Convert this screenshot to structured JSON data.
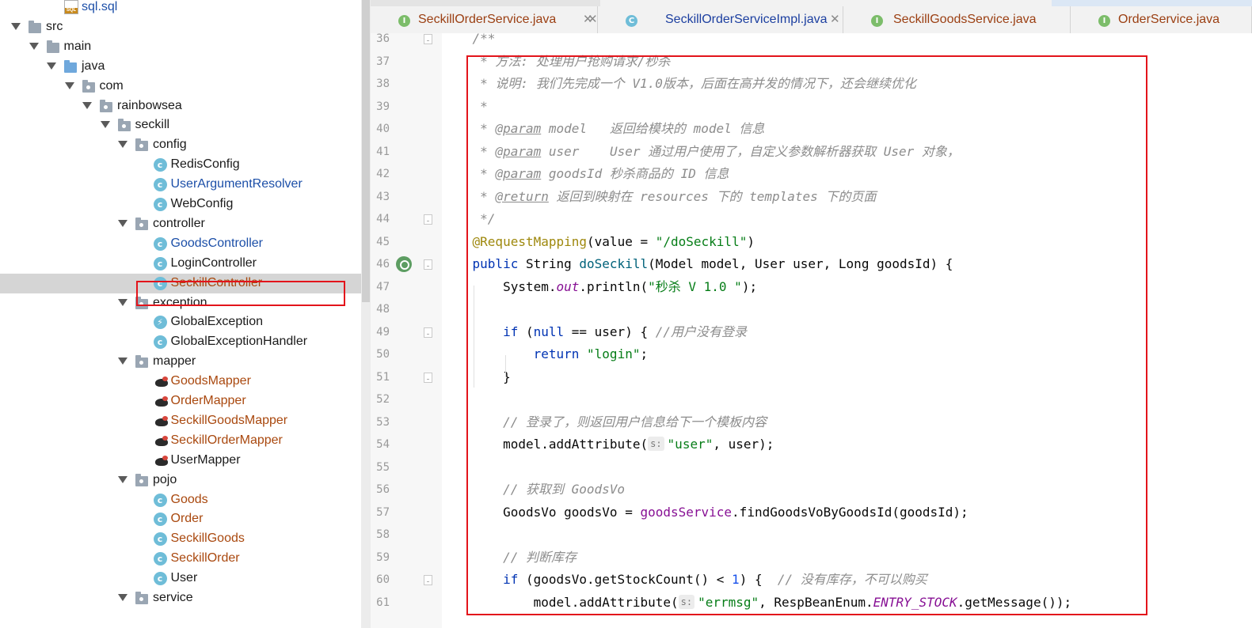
{
  "project_tree": {
    "items": [
      {
        "label": "sql.sql",
        "icon": "sql-file-icon",
        "kind": "sql",
        "color": "blue"
      },
      {
        "label": "src",
        "icon": "folder-icon",
        "kind": "folder",
        "expanded": true
      },
      {
        "label": "main",
        "icon": "folder-icon",
        "kind": "folder",
        "expanded": true
      },
      {
        "label": "java",
        "icon": "source-folder-icon",
        "kind": "srcfolder",
        "expanded": true
      },
      {
        "label": "com",
        "icon": "package-icon",
        "kind": "package",
        "expanded": true
      },
      {
        "label": "rainbowsea",
        "icon": "package-icon",
        "kind": "package",
        "expanded": true
      },
      {
        "label": "seckill",
        "icon": "package-icon",
        "kind": "package",
        "expanded": true
      },
      {
        "label": "config",
        "icon": "package-icon",
        "kind": "package",
        "expanded": true
      },
      {
        "label": "RedisConfig",
        "icon": "class-icon",
        "kind": "class"
      },
      {
        "label": "UserArgumentResolver",
        "icon": "class-icon",
        "kind": "class",
        "color": "blue"
      },
      {
        "label": "WebConfig",
        "icon": "class-icon",
        "kind": "class"
      },
      {
        "label": "controller",
        "icon": "package-icon",
        "kind": "package",
        "expanded": true
      },
      {
        "label": "GoodsController",
        "icon": "class-icon",
        "kind": "class",
        "color": "blue"
      },
      {
        "label": "LoginController",
        "icon": "class-icon",
        "kind": "class"
      },
      {
        "label": "SeckillController",
        "icon": "class-icon",
        "kind": "class",
        "color": "brown",
        "selected": true
      },
      {
        "label": "exception",
        "icon": "package-icon",
        "kind": "package",
        "expanded": true
      },
      {
        "label": "GlobalException",
        "icon": "exception-class-icon",
        "kind": "exception"
      },
      {
        "label": "GlobalExceptionHandler",
        "icon": "class-icon",
        "kind": "class"
      },
      {
        "label": "mapper",
        "icon": "package-icon",
        "kind": "package",
        "expanded": true
      },
      {
        "label": "GoodsMapper",
        "icon": "mybatis-mapper-icon",
        "kind": "mapper",
        "color": "brown"
      },
      {
        "label": "OrderMapper",
        "icon": "mybatis-mapper-icon",
        "kind": "mapper",
        "color": "brown"
      },
      {
        "label": "SeckillGoodsMapper",
        "icon": "mybatis-mapper-icon",
        "kind": "mapper",
        "color": "brown"
      },
      {
        "label": "SeckillOrderMapper",
        "icon": "mybatis-mapper-icon",
        "kind": "mapper",
        "color": "brown"
      },
      {
        "label": "UserMapper",
        "icon": "mybatis-mapper-icon",
        "kind": "mapper"
      },
      {
        "label": "pojo",
        "icon": "package-icon",
        "kind": "package",
        "expanded": true
      },
      {
        "label": "Goods",
        "icon": "class-icon",
        "kind": "class",
        "color": "brown"
      },
      {
        "label": "Order",
        "icon": "class-icon",
        "kind": "class",
        "color": "brown"
      },
      {
        "label": "SeckillGoods",
        "icon": "class-icon",
        "kind": "class",
        "color": "brown"
      },
      {
        "label": "SeckillOrder",
        "icon": "class-icon",
        "kind": "class",
        "color": "brown"
      },
      {
        "label": "User",
        "icon": "class-icon",
        "kind": "class"
      },
      {
        "label": "service",
        "icon": "package-icon",
        "kind": "package",
        "expanded": true
      }
    ]
  },
  "editor_tabs": [
    {
      "label": "SeckillOrderService.java",
      "icon": "interface-icon",
      "kind": "i",
      "color": "brown"
    },
    {
      "label": "SeckillOrderServiceImpl.java",
      "icon": "class-icon",
      "kind": "c",
      "color": "blue"
    },
    {
      "label": "SeckillGoodsService.java",
      "icon": "interface-icon",
      "kind": "i",
      "color": "brown"
    },
    {
      "label": "OrderService.java",
      "icon": "interface-icon",
      "kind": "i",
      "color": "brown"
    }
  ],
  "editor": {
    "line_numbers": [
      "36",
      "37",
      "38",
      "39",
      "40",
      "41",
      "42",
      "43",
      "44",
      "45",
      "46",
      "47",
      "48",
      "49",
      "50",
      "51",
      "52",
      "53",
      "54",
      "55",
      "56",
      "57",
      "58",
      "59",
      "60",
      "61"
    ],
    "lines": [
      [
        {
          "t": "    /**",
          "c": "cm"
        }
      ],
      [
        {
          "t": "     * 方法: 处理用户抢购请求/秒杀",
          "c": "cm"
        }
      ],
      [
        {
          "t": "     * 说明: 我们先完成一个 V1.0版本，后面在高并发的情况下，还会继续优化",
          "c": "cm"
        }
      ],
      [
        {
          "t": "     *",
          "c": "cm"
        }
      ],
      [
        {
          "t": "     * ",
          "c": "cm"
        },
        {
          "t": "@param",
          "c": "tagp"
        },
        {
          "t": " model",
          "c": "cm"
        },
        {
          "t": "   返回给模块的 model 信息",
          "c": "cm"
        }
      ],
      [
        {
          "t": "     * ",
          "c": "cm"
        },
        {
          "t": "@param",
          "c": "tagp"
        },
        {
          "t": " user",
          "c": "cm"
        },
        {
          "t": "    User 通过用户使用了，自定义参数解析器获取 User 对象，",
          "c": "cm"
        }
      ],
      [
        {
          "t": "     * ",
          "c": "cm"
        },
        {
          "t": "@param",
          "c": "tagp"
        },
        {
          "t": " goodsId",
          "c": "cm"
        },
        {
          "t": " 秒杀商品的 ID 信息",
          "c": "cm"
        }
      ],
      [
        {
          "t": "     * ",
          "c": "cm"
        },
        {
          "t": "@return",
          "c": "tagp"
        },
        {
          "t": " 返回到映射在 resources 下的 templates 下的页面",
          "c": "cm"
        }
      ],
      [
        {
          "t": "     */",
          "c": "cm"
        }
      ],
      [
        {
          "t": "    "
        },
        {
          "t": "@RequestMapping",
          "c": "ann"
        },
        {
          "t": "(value = "
        },
        {
          "t": "\"/doSeckill\"",
          "c": "str"
        },
        {
          "t": ")"
        }
      ],
      [
        {
          "t": "    "
        },
        {
          "t": "public",
          "c": "kw"
        },
        {
          "t": " String "
        },
        {
          "t": "doSeckill",
          "c": "mth"
        },
        {
          "t": "(Model model, User user, Long goodsId) {"
        }
      ],
      [
        {
          "t": "        System."
        },
        {
          "t": "out",
          "c": "stf"
        },
        {
          "t": ".println("
        },
        {
          "t": "\"秒杀 V 1.0 \"",
          "c": "str"
        },
        {
          "t": ");"
        }
      ],
      [
        {
          "t": ""
        }
      ],
      [
        {
          "t": "        "
        },
        {
          "t": "if",
          "c": "kw"
        },
        {
          "t": " ("
        },
        {
          "t": "null",
          "c": "kw"
        },
        {
          "t": " == user) { "
        },
        {
          "t": "//用户没有登录",
          "c": "cm"
        }
      ],
      [
        {
          "t": "            "
        },
        {
          "t": "return",
          "c": "kw"
        },
        {
          "t": " "
        },
        {
          "t": "\"login\"",
          "c": "str"
        },
        {
          "t": ";"
        }
      ],
      [
        {
          "t": "        }"
        }
      ],
      [
        {
          "t": ""
        }
      ],
      [
        {
          "t": "        "
        },
        {
          "t": "// 登录了，则返回用户信息给下一个模板内容",
          "c": "cm"
        }
      ],
      [
        {
          "t": "        model.addAttribute("
        },
        {
          "t": "s:",
          "c": "hint"
        },
        {
          "t": "\"user\"",
          "c": "str"
        },
        {
          "t": ", user);"
        }
      ],
      [
        {
          "t": ""
        }
      ],
      [
        {
          "t": "        "
        },
        {
          "t": "// 获取到 GoodsVo",
          "c": "cm"
        }
      ],
      [
        {
          "t": "        GoodsVo goodsVo = "
        },
        {
          "t": "goodsService",
          "c": "fld"
        },
        {
          "t": ".findGoodsVoByGoodsId(goodsId);"
        }
      ],
      [
        {
          "t": ""
        }
      ],
      [
        {
          "t": "        "
        },
        {
          "t": "// 判断库存",
          "c": "cm"
        }
      ],
      [
        {
          "t": "        "
        },
        {
          "t": "if",
          "c": "kw"
        },
        {
          "t": " (goodsVo.getStockCount() < "
        },
        {
          "t": "1",
          "c": "num"
        },
        {
          "t": ") {  "
        },
        {
          "t": "// 没有库存，不可以购买",
          "c": "cm"
        }
      ],
      [
        {
          "t": "            model.addAttribute("
        },
        {
          "t": "s:",
          "c": "hint"
        },
        {
          "t": "\"errmsg\"",
          "c": "str"
        },
        {
          "t": ", RespBeanEnum."
        },
        {
          "t": "ENTRY_STOCK",
          "c": "stf"
        },
        {
          "t": ".getMessage());"
        }
      ]
    ]
  }
}
